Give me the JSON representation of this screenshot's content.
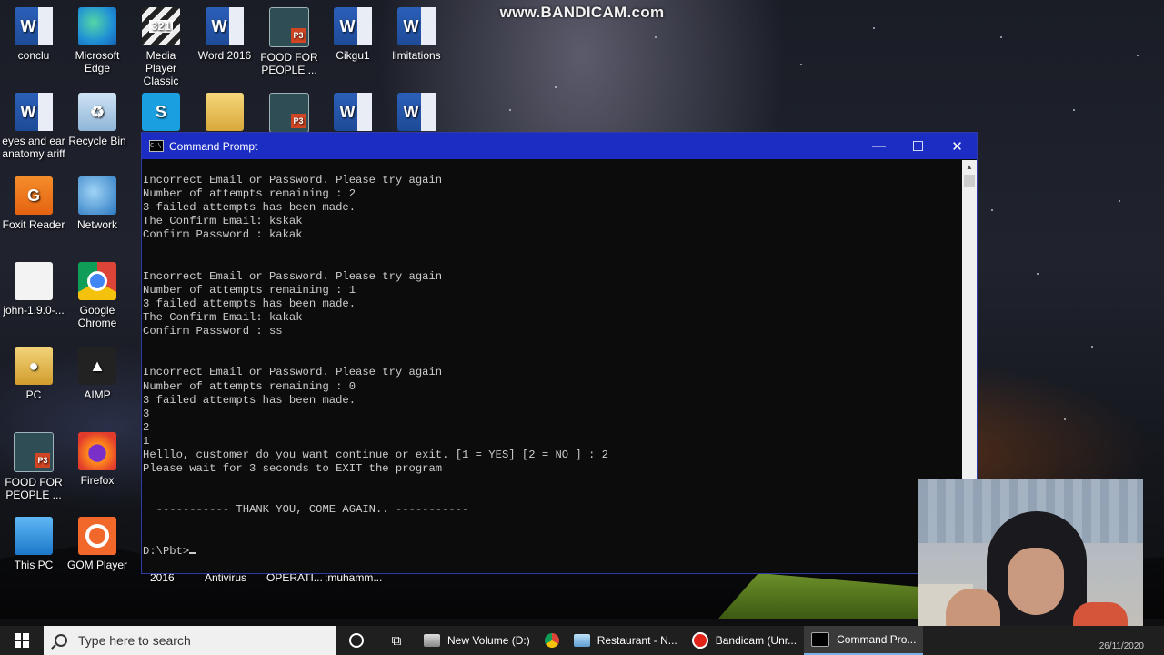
{
  "watermark": "www.BANDICAM.com",
  "desktop_icons": [
    {
      "label": "conclu",
      "icon": "word-doc-icon"
    },
    {
      "label": "Microsoft Edge",
      "icon": "edge-icon"
    },
    {
      "label": "Media Player Classic",
      "icon": "media-player-icon"
    },
    {
      "label": "Word 2016",
      "icon": "word-app-icon"
    },
    {
      "label": "FOOD FOR PEOPLE ...",
      "icon": "powerpoint-file-icon"
    },
    {
      "label": "Cikgu1",
      "icon": "word-doc-icon"
    },
    {
      "label": "limitations",
      "icon": "word-doc-icon"
    },
    {
      "label": "eyes and ear anatomy ariff",
      "icon": "word-doc-icon"
    },
    {
      "label": "Recycle Bin",
      "icon": "recycle-bin-icon"
    },
    {
      "label": "Foxit Reader",
      "icon": "foxit-reader-icon"
    },
    {
      "label": "Network",
      "icon": "network-icon"
    },
    {
      "label": "john-1.9.0-...",
      "icon": "file-icon"
    },
    {
      "label": "Google Chrome",
      "icon": "chrome-icon"
    },
    {
      "label": "PC",
      "icon": "pc-folder-icon"
    },
    {
      "label": "AIMP",
      "icon": "aimp-icon"
    },
    {
      "label": "FOOD FOR PEOPLE ...",
      "icon": "powerpoint-file-icon"
    },
    {
      "label": "Firefox",
      "icon": "firefox-icon"
    },
    {
      "label": "This PC",
      "icon": "this-pc-icon"
    },
    {
      "label": "GOM Player",
      "icon": "gom-player-icon"
    }
  ],
  "hidden_labels": {
    "label_2016": "2016",
    "antivirus": "Antivirus",
    "operati": "OPERATI...",
    "muhamm": ";muhamm..."
  },
  "cmd": {
    "title": "Command Prompt",
    "icon_text": "C:\\",
    "minimize": "—",
    "maximize": "☐",
    "close": "✕",
    "lines": [
      "",
      "Incorrect Email or Password. Please try again",
      "Number of attempts remaining : 2",
      "3 failed attempts has been made.",
      "The Confirm Email: kskak",
      "Confirm Password : kakak",
      "",
      "",
      "Incorrect Email or Password. Please try again",
      "Number of attempts remaining : 1",
      "3 failed attempts has been made.",
      "The Confirm Email: kakak",
      "Confirm Password : ss",
      "",
      "",
      "Incorrect Email or Password. Please try again",
      "Number of attempts remaining : 0",
      "3 failed attempts has been made.",
      "3",
      "2",
      "1",
      "Helllo, customer do you want continue or exit. [1 = YES] [2 = NO ] : 2",
      "Please wait for 3 seconds to EXIT the program",
      "",
      "",
      "  ----------- THANK YOU, COME AGAIN.. -----------",
      "",
      ""
    ],
    "prompt": "D:\\Pbt>"
  },
  "taskbar": {
    "search_placeholder": "Type here to search",
    "items": [
      {
        "label": "New Volume (D:)",
        "icon": "drive-icon"
      },
      {
        "label": "",
        "icon": "chrome-icon"
      },
      {
        "label": "Restaurant - N...",
        "icon": "notepad-icon"
      },
      {
        "label": "Bandicam (Unr...",
        "icon": "bandicam-icon"
      },
      {
        "label": "Command Pro...",
        "icon": "cmd-icon"
      }
    ],
    "clock": "26/11/2020"
  },
  "colors": {
    "title_bar": "#1c2dc4",
    "console_bg": "#0c0c0c",
    "console_text": "#cccccc",
    "taskbar": "#1f1f1f"
  }
}
